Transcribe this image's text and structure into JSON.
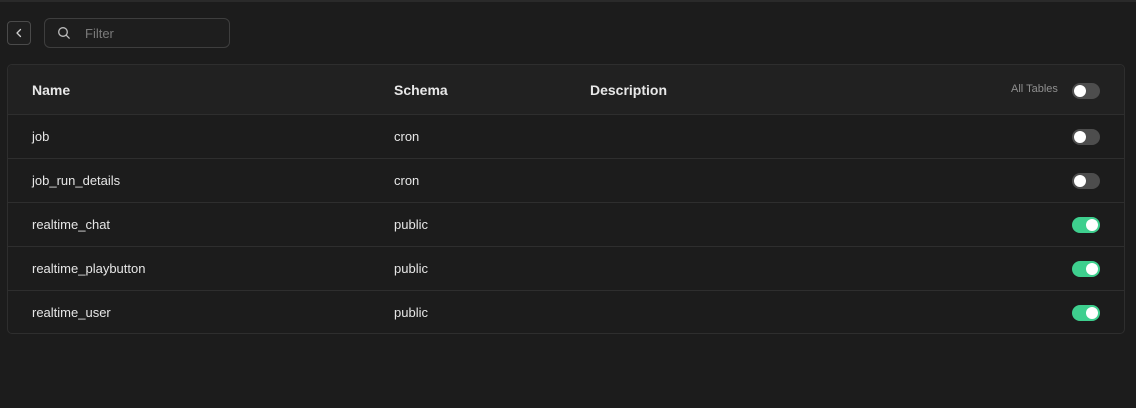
{
  "search": {
    "placeholder": "Filter"
  },
  "table": {
    "columns": {
      "name": "Name",
      "schema": "Schema",
      "description": "Description"
    },
    "all_tables_label": "All Tables",
    "all_tables_enabled": false,
    "rows": [
      {
        "name": "job",
        "schema": "cron",
        "description": "",
        "enabled": false
      },
      {
        "name": "job_run_details",
        "schema": "cron",
        "description": "",
        "enabled": false
      },
      {
        "name": "realtime_chat",
        "schema": "public",
        "description": "",
        "enabled": true
      },
      {
        "name": "realtime_playbutton",
        "schema": "public",
        "description": "",
        "enabled": true
      },
      {
        "name": "realtime_user",
        "schema": "public",
        "description": "",
        "enabled": true
      }
    ]
  },
  "colors": {
    "toggle_on": "#3ecf8e",
    "toggle_off": "#4d4d4d",
    "background": "#1c1c1c"
  },
  "icons": {
    "back": "chevron-left-icon",
    "search": "search-icon"
  }
}
